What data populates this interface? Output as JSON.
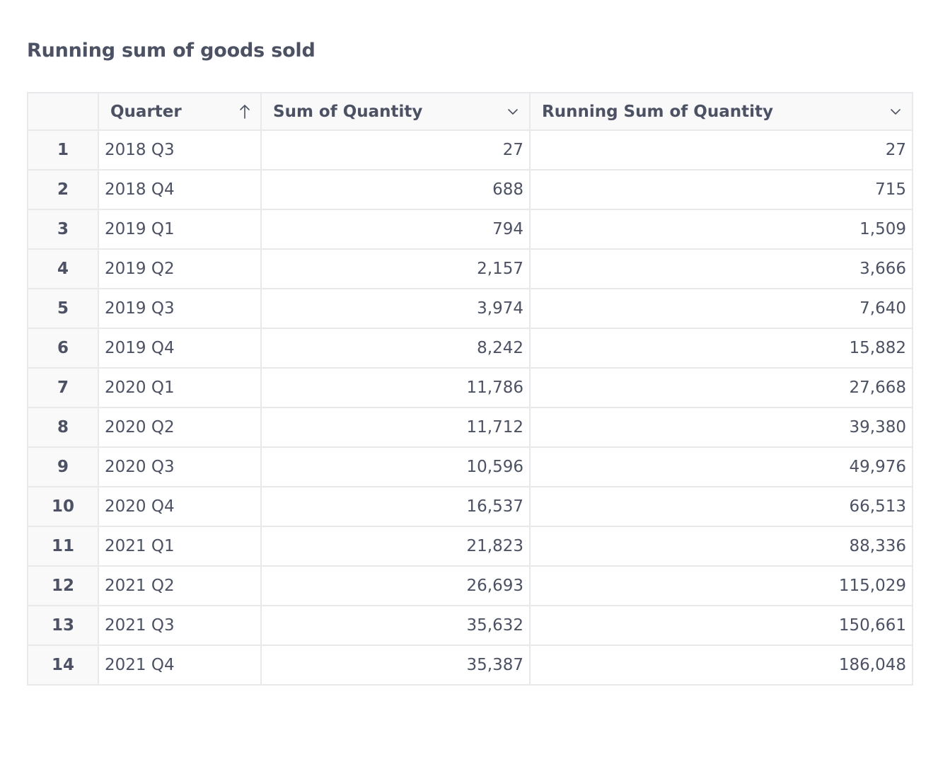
{
  "title": "Running sum of goods sold",
  "columns": {
    "quarter": {
      "label": "Quarter",
      "icon": "sort-ascending-icon"
    },
    "sum_qty": {
      "label": "Sum of Quantity",
      "icon": "chevron-down-icon"
    },
    "running_qty": {
      "label": "Running Sum of Quantity",
      "icon": "chevron-down-icon"
    }
  },
  "rows": [
    {
      "index": "1",
      "quarter": "2018 Q3",
      "sum": "27",
      "running": "27"
    },
    {
      "index": "2",
      "quarter": "2018 Q4",
      "sum": "688",
      "running": "715"
    },
    {
      "index": "3",
      "quarter": "2019 Q1",
      "sum": "794",
      "running": "1,509"
    },
    {
      "index": "4",
      "quarter": "2019 Q2",
      "sum": "2,157",
      "running": "3,666"
    },
    {
      "index": "5",
      "quarter": "2019 Q3",
      "sum": "3,974",
      "running": "7,640"
    },
    {
      "index": "6",
      "quarter": "2019 Q4",
      "sum": "8,242",
      "running": "15,882"
    },
    {
      "index": "7",
      "quarter": "2020 Q1",
      "sum": "11,786",
      "running": "27,668"
    },
    {
      "index": "8",
      "quarter": "2020 Q2",
      "sum": "11,712",
      "running": "39,380"
    },
    {
      "index": "9",
      "quarter": "2020 Q3",
      "sum": "10,596",
      "running": "49,976"
    },
    {
      "index": "10",
      "quarter": "2020 Q4",
      "sum": "16,537",
      "running": "66,513"
    },
    {
      "index": "11",
      "quarter": "2021 Q1",
      "sum": "21,823",
      "running": "88,336"
    },
    {
      "index": "12",
      "quarter": "2021 Q2",
      "sum": "26,693",
      "running": "115,029"
    },
    {
      "index": "13",
      "quarter": "2021 Q3",
      "sum": "35,632",
      "running": "150,661"
    },
    {
      "index": "14",
      "quarter": "2021 Q4",
      "sum": "35,387",
      "running": "186,048"
    }
  ]
}
